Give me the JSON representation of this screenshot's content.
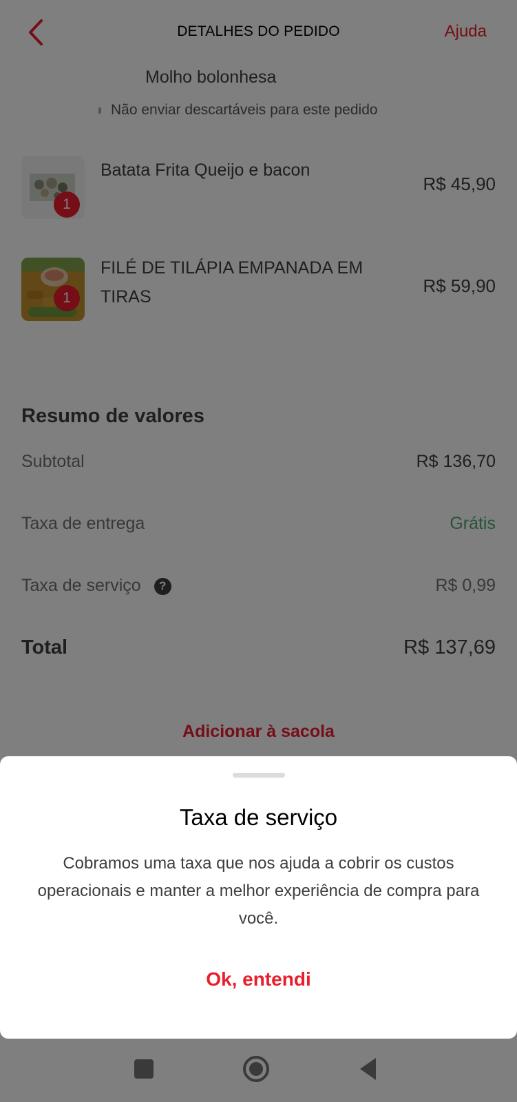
{
  "header": {
    "title": "DETALHES DO PEDIDO",
    "help_label": "Ajuda"
  },
  "order": {
    "option_text": "Molho bolonhesa",
    "no_disposables_text": "Não enviar descartáveis para este pedido",
    "items": [
      {
        "name": "Batata Frita Queijo e bacon",
        "price": "R$ 45,90",
        "quantity": "1"
      },
      {
        "name": "FILÉ DE TILÁPIA EMPANADA EM TIRAS",
        "price": "R$ 59,90",
        "quantity": "1"
      }
    ]
  },
  "summary": {
    "title": "Resumo de valores",
    "subtotal_label": "Subtotal",
    "subtotal_value": "R$ 136,70",
    "delivery_label": "Taxa de entrega",
    "delivery_value": "Grátis",
    "service_label": "Taxa de serviço",
    "service_value": "R$ 0,99",
    "info_icon": "?",
    "total_label": "Total",
    "total_value": "R$ 137,69"
  },
  "add_to_bag_label": "Adicionar à sacola",
  "sheet": {
    "title": "Taxa de serviço",
    "body": "Cobramos uma taxa que nos ajuda a cobrir os custos operacionais e manter a melhor experiência de compra para você.",
    "ok_label": "Ok, entendi"
  },
  "colors": {
    "accent": "#ea1d2c",
    "green": "#50a773",
    "overlay": "rgba(0,0,0,0.5)"
  },
  "icons": {
    "back": "chevron-left-icon",
    "info": "question-circle-icon",
    "nav_recents": "square-icon",
    "nav_home": "circle-icon",
    "nav_back": "triangle-back-icon"
  }
}
